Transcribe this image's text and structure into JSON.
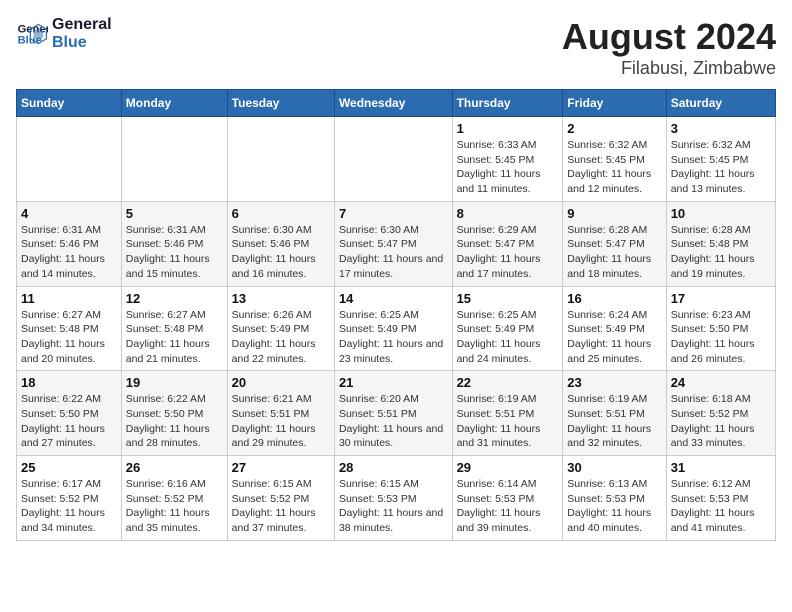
{
  "logo": {
    "line1": "General",
    "line2": "Blue"
  },
  "title": "August 2024",
  "subtitle": "Filabusi, Zimbabwe",
  "days_of_week": [
    "Sunday",
    "Monday",
    "Tuesday",
    "Wednesday",
    "Thursday",
    "Friday",
    "Saturday"
  ],
  "weeks": [
    [
      {
        "day": "",
        "info": ""
      },
      {
        "day": "",
        "info": ""
      },
      {
        "day": "",
        "info": ""
      },
      {
        "day": "",
        "info": ""
      },
      {
        "day": "1",
        "info": "Sunrise: 6:33 AM\nSunset: 5:45 PM\nDaylight: 11 hours and 11 minutes."
      },
      {
        "day": "2",
        "info": "Sunrise: 6:32 AM\nSunset: 5:45 PM\nDaylight: 11 hours and 12 minutes."
      },
      {
        "day": "3",
        "info": "Sunrise: 6:32 AM\nSunset: 5:45 PM\nDaylight: 11 hours and 13 minutes."
      }
    ],
    [
      {
        "day": "4",
        "info": "Sunrise: 6:31 AM\nSunset: 5:46 PM\nDaylight: 11 hours and 14 minutes."
      },
      {
        "day": "5",
        "info": "Sunrise: 6:31 AM\nSunset: 5:46 PM\nDaylight: 11 hours and 15 minutes."
      },
      {
        "day": "6",
        "info": "Sunrise: 6:30 AM\nSunset: 5:46 PM\nDaylight: 11 hours and 16 minutes."
      },
      {
        "day": "7",
        "info": "Sunrise: 6:30 AM\nSunset: 5:47 PM\nDaylight: 11 hours and 17 minutes."
      },
      {
        "day": "8",
        "info": "Sunrise: 6:29 AM\nSunset: 5:47 PM\nDaylight: 11 hours and 17 minutes."
      },
      {
        "day": "9",
        "info": "Sunrise: 6:28 AM\nSunset: 5:47 PM\nDaylight: 11 hours and 18 minutes."
      },
      {
        "day": "10",
        "info": "Sunrise: 6:28 AM\nSunset: 5:48 PM\nDaylight: 11 hours and 19 minutes."
      }
    ],
    [
      {
        "day": "11",
        "info": "Sunrise: 6:27 AM\nSunset: 5:48 PM\nDaylight: 11 hours and 20 minutes."
      },
      {
        "day": "12",
        "info": "Sunrise: 6:27 AM\nSunset: 5:48 PM\nDaylight: 11 hours and 21 minutes."
      },
      {
        "day": "13",
        "info": "Sunrise: 6:26 AM\nSunset: 5:49 PM\nDaylight: 11 hours and 22 minutes."
      },
      {
        "day": "14",
        "info": "Sunrise: 6:25 AM\nSunset: 5:49 PM\nDaylight: 11 hours and 23 minutes."
      },
      {
        "day": "15",
        "info": "Sunrise: 6:25 AM\nSunset: 5:49 PM\nDaylight: 11 hours and 24 minutes."
      },
      {
        "day": "16",
        "info": "Sunrise: 6:24 AM\nSunset: 5:49 PM\nDaylight: 11 hours and 25 minutes."
      },
      {
        "day": "17",
        "info": "Sunrise: 6:23 AM\nSunset: 5:50 PM\nDaylight: 11 hours and 26 minutes."
      }
    ],
    [
      {
        "day": "18",
        "info": "Sunrise: 6:22 AM\nSunset: 5:50 PM\nDaylight: 11 hours and 27 minutes."
      },
      {
        "day": "19",
        "info": "Sunrise: 6:22 AM\nSunset: 5:50 PM\nDaylight: 11 hours and 28 minutes."
      },
      {
        "day": "20",
        "info": "Sunrise: 6:21 AM\nSunset: 5:51 PM\nDaylight: 11 hours and 29 minutes."
      },
      {
        "day": "21",
        "info": "Sunrise: 6:20 AM\nSunset: 5:51 PM\nDaylight: 11 hours and 30 minutes."
      },
      {
        "day": "22",
        "info": "Sunrise: 6:19 AM\nSunset: 5:51 PM\nDaylight: 11 hours and 31 minutes."
      },
      {
        "day": "23",
        "info": "Sunrise: 6:19 AM\nSunset: 5:51 PM\nDaylight: 11 hours and 32 minutes."
      },
      {
        "day": "24",
        "info": "Sunrise: 6:18 AM\nSunset: 5:52 PM\nDaylight: 11 hours and 33 minutes."
      }
    ],
    [
      {
        "day": "25",
        "info": "Sunrise: 6:17 AM\nSunset: 5:52 PM\nDaylight: 11 hours and 34 minutes."
      },
      {
        "day": "26",
        "info": "Sunrise: 6:16 AM\nSunset: 5:52 PM\nDaylight: 11 hours and 35 minutes."
      },
      {
        "day": "27",
        "info": "Sunrise: 6:15 AM\nSunset: 5:52 PM\nDaylight: 11 hours and 37 minutes."
      },
      {
        "day": "28",
        "info": "Sunrise: 6:15 AM\nSunset: 5:53 PM\nDaylight: 11 hours and 38 minutes."
      },
      {
        "day": "29",
        "info": "Sunrise: 6:14 AM\nSunset: 5:53 PM\nDaylight: 11 hours and 39 minutes."
      },
      {
        "day": "30",
        "info": "Sunrise: 6:13 AM\nSunset: 5:53 PM\nDaylight: 11 hours and 40 minutes."
      },
      {
        "day": "31",
        "info": "Sunrise: 6:12 AM\nSunset: 5:53 PM\nDaylight: 11 hours and 41 minutes."
      }
    ]
  ]
}
